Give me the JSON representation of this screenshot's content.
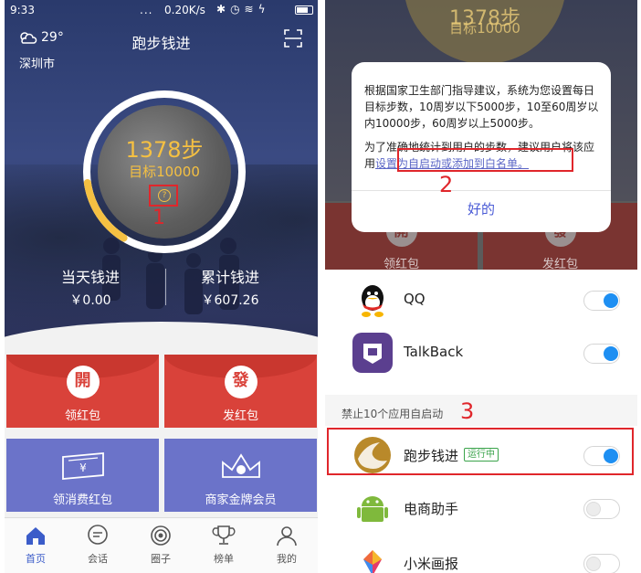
{
  "status_bar": {
    "time": "9:33",
    "dots": "...",
    "network_speed": "0.20K/s"
  },
  "header": {
    "temperature": "29°",
    "city": "深圳市",
    "title": "跑步钱进"
  },
  "ring": {
    "steps": "1378步",
    "goal": "目标10000",
    "help_glyph": "?",
    "progress_fraction": 0.14
  },
  "stats": {
    "today_title": "当天钱进",
    "today_value": "￥0.00",
    "total_title": "累计钱进",
    "total_value": "￥607.26"
  },
  "tiles": [
    {
      "label": "领红包",
      "glyph": "開",
      "color": "#d9423a"
    },
    {
      "label": "发红包",
      "glyph": "發",
      "color": "#d9423a"
    },
    {
      "label": "领消费红包",
      "icon": "coupon-icon",
      "color": "#6b73c9"
    },
    {
      "label": "商家金牌会员",
      "icon": "crown-icon",
      "color": "#6b73c9"
    }
  ],
  "tabbar": [
    {
      "label": "首页",
      "icon": "home-icon",
      "active": true
    },
    {
      "label": "会话",
      "icon": "chat-icon",
      "active": false
    },
    {
      "label": "圈子",
      "icon": "circle-icon",
      "active": false
    },
    {
      "label": "榜单",
      "icon": "trophy-icon",
      "active": false
    },
    {
      "label": "我的",
      "icon": "person-icon",
      "active": false
    }
  ],
  "annotations": {
    "one": "1",
    "two": "2",
    "three": "3"
  },
  "dialog_screen": {
    "steps": "1378步",
    "goal": "目标10000",
    "tile_labels": [
      "领红包",
      "发红包"
    ],
    "tile_glyphs": [
      "開",
      "發"
    ]
  },
  "dialog": {
    "paragraph1": "根据国家卫生部门指导建议，系统为您设置每日目标步数，10周岁以下5000步，10至60周岁以内10000步，60周岁以上5000步。",
    "paragraph2_prefix": "为了准确地统计到用户的步数，建议用户将该应用",
    "paragraph2_link": "设置为自启动或添加到白名单。",
    "ok_label": "好的"
  },
  "autostart_list": {
    "enabled_apps": [
      {
        "name": "QQ",
        "icon": "qq-icon",
        "on": true
      },
      {
        "name": "TalkBack",
        "icon": "talkback-icon",
        "on": true
      }
    ],
    "section_label": "禁止10个应用自启动",
    "disabled_apps": [
      {
        "name": "跑步钱进",
        "badge": "运行中",
        "icon": "running-money-icon",
        "on": true
      },
      {
        "name": "电商助手",
        "icon": "android-icon",
        "on": false
      },
      {
        "name": "小米画报",
        "icon": "mi-wallpaper-icon",
        "on": false
      }
    ]
  },
  "colors": {
    "accent_blue": "#3b5cc9",
    "toggle_blue": "#1e8ff2",
    "step_gold": "#f5c042",
    "annotation_red": "#e0262b",
    "tile_red": "#d9423a",
    "tile_purple": "#6b73c9"
  }
}
